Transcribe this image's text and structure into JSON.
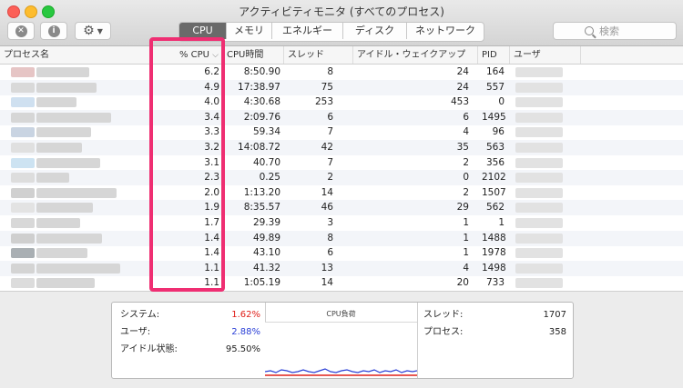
{
  "window": {
    "title": "アクティビティモニタ (すべてのプロセス)"
  },
  "toolbar": {
    "stop_icon": "x-circle-icon",
    "info_icon": "info-circle-icon",
    "info_glyph": "i",
    "gear_icon": "gear-icon",
    "tabs": [
      "CPU",
      "メモリ",
      "エネルギー",
      "ディスク",
      "ネットワーク"
    ],
    "active_tab": "CPU",
    "search_placeholder": "検索"
  },
  "table": {
    "columns": [
      "プロセス名",
      "% CPU",
      "CPU時間",
      "スレッド",
      "アイドル・ウェイクアップ",
      "PID",
      "ユーザ"
    ],
    "sort_indicator": "⌵",
    "rows": [
      {
        "cpu": "6.2",
        "time": "8:50.90",
        "threads": "8",
        "wakeups": "24",
        "pid": "164"
      },
      {
        "cpu": "4.9",
        "time": "17:38.97",
        "threads": "75",
        "wakeups": "24",
        "pid": "557"
      },
      {
        "cpu": "4.0",
        "time": "4:30.68",
        "threads": "253",
        "wakeups": "453",
        "pid": "0"
      },
      {
        "cpu": "3.4",
        "time": "2:09.76",
        "threads": "6",
        "wakeups": "6",
        "pid": "1495"
      },
      {
        "cpu": "3.3",
        "time": "59.34",
        "threads": "7",
        "wakeups": "4",
        "pid": "96"
      },
      {
        "cpu": "3.2",
        "time": "14:08.72",
        "threads": "42",
        "wakeups": "35",
        "pid": "563"
      },
      {
        "cpu": "3.1",
        "time": "40.70",
        "threads": "7",
        "wakeups": "2",
        "pid": "356"
      },
      {
        "cpu": "2.3",
        "time": "0.25",
        "threads": "2",
        "wakeups": "0",
        "pid": "2102"
      },
      {
        "cpu": "2.0",
        "time": "1:13.20",
        "threads": "14",
        "wakeups": "2",
        "pid": "1507"
      },
      {
        "cpu": "1.9",
        "time": "8:35.57",
        "threads": "46",
        "wakeups": "29",
        "pid": "562"
      },
      {
        "cpu": "1.7",
        "time": "29.39",
        "threads": "3",
        "wakeups": "1",
        "pid": "1"
      },
      {
        "cpu": "1.4",
        "time": "49.89",
        "threads": "8",
        "wakeups": "1",
        "pid": "1488"
      },
      {
        "cpu": "1.4",
        "time": "43.10",
        "threads": "6",
        "wakeups": "1",
        "pid": "1978"
      },
      {
        "cpu": "1.1",
        "time": "41.32",
        "threads": "13",
        "wakeups": "4",
        "pid": "1498"
      },
      {
        "cpu": "1.1",
        "time": "1:05.19",
        "threads": "14",
        "wakeups": "20",
        "pid": "733"
      }
    ]
  },
  "summary": {
    "system": {
      "label": "システム:",
      "value": "1.62%",
      "color": "#e0201a"
    },
    "user": {
      "label": "ユーザ:",
      "value": "2.88%",
      "color": "#2a3fd6"
    },
    "idle": {
      "label": "アイドル状態:",
      "value": "95.50%"
    },
    "cpu_load_title": "CPU負荷",
    "threads": {
      "label": "スレッド:",
      "value": "1707"
    },
    "processes": {
      "label": "プロセス:",
      "value": "358"
    }
  },
  "colors": {
    "highlight_border": "#ef2e72",
    "active_tab_bg": "#6a6a6a",
    "blurred": "#d6d6d6"
  }
}
